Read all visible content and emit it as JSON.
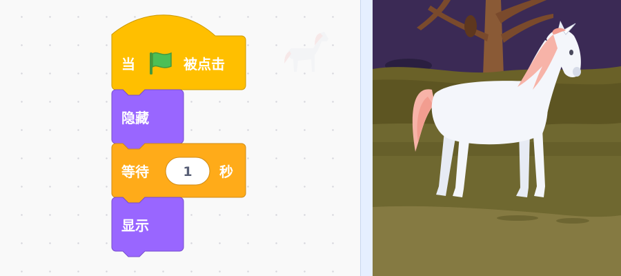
{
  "workspace": {
    "blocks": {
      "when_flag": {
        "before": "当",
        "after": "被点击",
        "icon": "green-flag-icon"
      },
      "hide": {
        "label": "隐藏"
      },
      "wait": {
        "before": "等待",
        "value": "1",
        "after": "秒"
      },
      "show": {
        "label": "显示"
      }
    },
    "sprite_thumbnail": {
      "icon": "unicorn-icon"
    }
  },
  "stage": {
    "sprite": {
      "icon": "unicorn-icon"
    },
    "backdrop": "night-forest"
  },
  "colors": {
    "events": "#ffbf00",
    "events_border": "#cc9900",
    "looks": "#9966ff",
    "looks_border": "#774dcb",
    "control": "#ffab19",
    "control_border": "#cf8b17",
    "flag_green": "#4cbf56"
  }
}
